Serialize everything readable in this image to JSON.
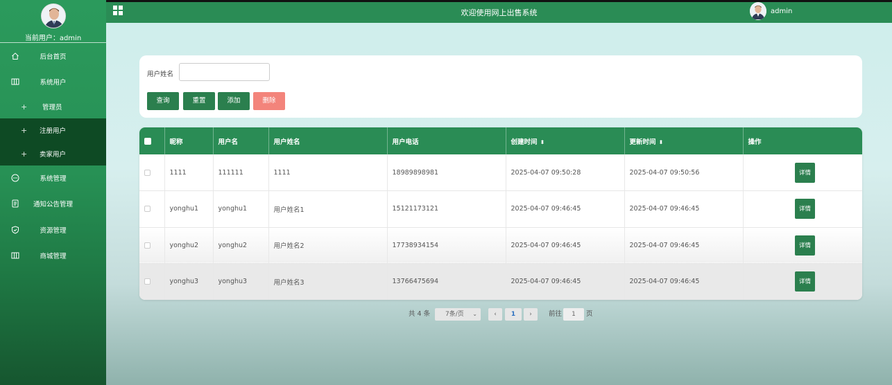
{
  "sidebar": {
    "current_user_label": "当前用户：",
    "current_user": "admin",
    "items": [
      {
        "label": "后台首页",
        "icon": "home-icon"
      },
      {
        "label": "系统用户",
        "icon": "columns-icon"
      },
      {
        "label": "管理员",
        "icon": "plus-icon"
      },
      {
        "label": "注册用户",
        "icon": "plus-icon"
      },
      {
        "label": "卖家用户",
        "icon": "plus-icon"
      },
      {
        "label": "系统管理",
        "icon": "chat-icon"
      },
      {
        "label": "通知公告管理",
        "icon": "document-icon"
      },
      {
        "label": "资源管理",
        "icon": "shield-check-icon"
      },
      {
        "label": "商城管理",
        "icon": "columns-icon"
      }
    ]
  },
  "header": {
    "title": "欢迎使用网上出售系统",
    "user": "admin"
  },
  "search": {
    "label": "用户姓名",
    "value": "",
    "buttons": {
      "query": "查询",
      "reset": "重置",
      "add": "添加",
      "delete": "删除"
    }
  },
  "table": {
    "columns": [
      "昵称",
      "用户名",
      "用户姓名",
      "用户电话",
      "创建时间",
      "更新时间",
      "操作"
    ],
    "rows": [
      {
        "nickname": "1111",
        "username": "111111",
        "realname": "1111",
        "phone": "18989898981",
        "created": "2025-04-07 09:50:28",
        "updated": "2025-04-07 09:50:56",
        "action": "详情"
      },
      {
        "nickname": "yonghu1",
        "username": "yonghu1",
        "realname": "用户姓名1",
        "phone": "15121173121",
        "created": "2025-04-07 09:46:45",
        "updated": "2025-04-07 09:46:45",
        "action": "详情"
      },
      {
        "nickname": "yonghu2",
        "username": "yonghu2",
        "realname": "用户姓名2",
        "phone": "17738934154",
        "created": "2025-04-07 09:46:45",
        "updated": "2025-04-07 09:46:45",
        "action": "详情"
      },
      {
        "nickname": "yonghu3",
        "username": "yonghu3",
        "realname": "用户姓名3",
        "phone": "13766475694",
        "created": "2025-04-07 09:46:45",
        "updated": "2025-04-07 09:46:45",
        "action": "详情"
      }
    ]
  },
  "pagination": {
    "total": "共 4 条",
    "page_size": "7条/页",
    "current_page": "1",
    "goto_label": "前往",
    "goto_value": "1",
    "page_suffix": "页"
  },
  "colors": {
    "primary": "#2a8c55",
    "delete": "#f3847b"
  }
}
